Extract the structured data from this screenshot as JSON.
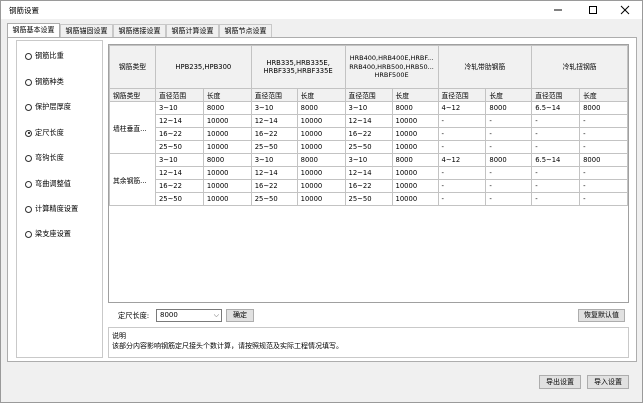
{
  "window": {
    "title": "钢筋设置"
  },
  "tabs": [
    "钢筋基本设置",
    "钢筋锚固设置",
    "钢筋搭接设置",
    "钢筋计算设置",
    "钢筋节点设置"
  ],
  "sidebar": {
    "items": [
      {
        "label": "钢筋比重",
        "checked": false
      },
      {
        "label": "钢筋种类",
        "checked": false
      },
      {
        "label": "保护层厚度",
        "checked": false
      },
      {
        "label": "定尺长度",
        "checked": true
      },
      {
        "label": "弯钩长度",
        "checked": false
      },
      {
        "label": "弯曲调整值",
        "checked": false
      },
      {
        "label": "计算精度设置",
        "checked": false
      },
      {
        "label": "梁支座设置",
        "checked": false
      }
    ]
  },
  "table": {
    "type_label": "钢筋类型",
    "group_headers": [
      "HPB235,HPB300",
      "HRB335,HRB335E,\nHRBF335,HRBF335E",
      "HRB400,HRB400E,HRBF...\nRRB400,HRB500,HRB50...\nHRBF500E",
      "冷轧带肋钢筋",
      "冷轧扭钢筋"
    ],
    "sub_headers": {
      "type": "钢筋类型",
      "range": "直径范围",
      "length": "长度"
    },
    "groups": [
      {
        "label": "墙柱垂直...",
        "rows": [
          [
            "3~10",
            "8000",
            "3~10",
            "8000",
            "3~10",
            "8000",
            "4~12",
            "8000",
            "6.5~14",
            "8000"
          ],
          [
            "12~14",
            "10000",
            "12~14",
            "10000",
            "12~14",
            "10000",
            "-",
            "-",
            "-",
            "-"
          ],
          [
            "16~22",
            "10000",
            "16~22",
            "10000",
            "16~22",
            "10000",
            "-",
            "-",
            "-",
            "-"
          ],
          [
            "25~50",
            "10000",
            "25~50",
            "10000",
            "25~50",
            "10000",
            "-",
            "-",
            "-",
            "-"
          ]
        ]
      },
      {
        "label": "其余钢筋...",
        "rows": [
          [
            "3~10",
            "8000",
            "3~10",
            "8000",
            "3~10",
            "8000",
            "4~12",
            "8000",
            "6.5~14",
            "8000"
          ],
          [
            "12~14",
            "10000",
            "12~14",
            "10000",
            "12~14",
            "10000",
            "-",
            "-",
            "-",
            "-"
          ],
          [
            "16~22",
            "10000",
            "16~22",
            "10000",
            "16~22",
            "10000",
            "-",
            "-",
            "-",
            "-"
          ],
          [
            "25~50",
            "10000",
            "25~50",
            "10000",
            "25~50",
            "10000",
            "-",
            "-",
            "-",
            "-"
          ]
        ]
      }
    ]
  },
  "fixed_length": {
    "label": "定尺长度:",
    "value": "8000",
    "confirm": "确定"
  },
  "reset_label": "恢复默认值",
  "description": {
    "heading": "说明",
    "text": "该部分内容影响钢筋定尺接头个数计算，请按照规范及实际工程情况填写。"
  },
  "footer": {
    "export": "导出设置",
    "import": "导入设置"
  },
  "icons": {
    "minimize": "minimize-icon",
    "maximize": "maximize-icon",
    "close": "close-icon",
    "dropdown": "chevron-down-icon"
  }
}
